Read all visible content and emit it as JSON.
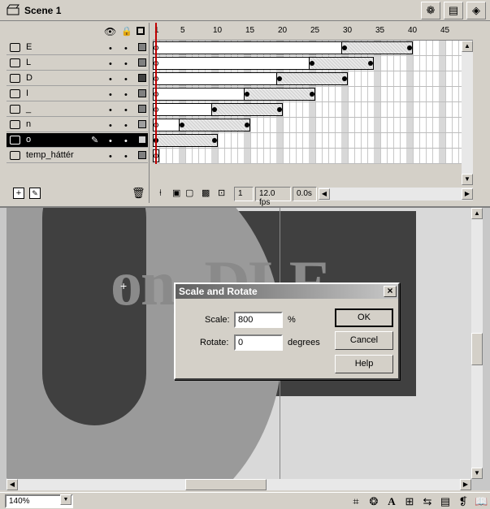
{
  "scene": {
    "label": "Scene 1"
  },
  "toolbar": {
    "edit_scene_icon": "film-clapper-icon",
    "edit_symbol_icon": "shapes-icon"
  },
  "timeline": {
    "ruler": [
      "1",
      "5",
      "10",
      "15",
      "20",
      "25",
      "30",
      "35",
      "40",
      "45"
    ],
    "layers": [
      {
        "name": "E",
        "swatch": "#808080"
      },
      {
        "name": "L",
        "swatch": "#808080"
      },
      {
        "name": "D",
        "swatch": "#404040"
      },
      {
        "name": "I",
        "swatch": "#808080"
      },
      {
        "name": "_",
        "swatch": "#808080"
      },
      {
        "name": "n",
        "swatch": "#a0a0a0"
      },
      {
        "name": "o",
        "swatch": "#d0d0d0",
        "selected": true
      },
      {
        "name": "temp_háttér",
        "swatch": "#808080"
      }
    ],
    "frame": "1",
    "fps": "12.0 fps",
    "time": "0.0s"
  },
  "stage": {
    "text": "on_DLE"
  },
  "dialog": {
    "title": "Scale and Rotate",
    "scale_label": "Scale:",
    "scale_value": "800",
    "scale_unit": "%",
    "rotate_label": "Rotate:",
    "rotate_value": "0",
    "rotate_unit": "degrees",
    "ok": "OK",
    "cancel": "Cancel",
    "help": "Help"
  },
  "status": {
    "zoom": "140%"
  }
}
